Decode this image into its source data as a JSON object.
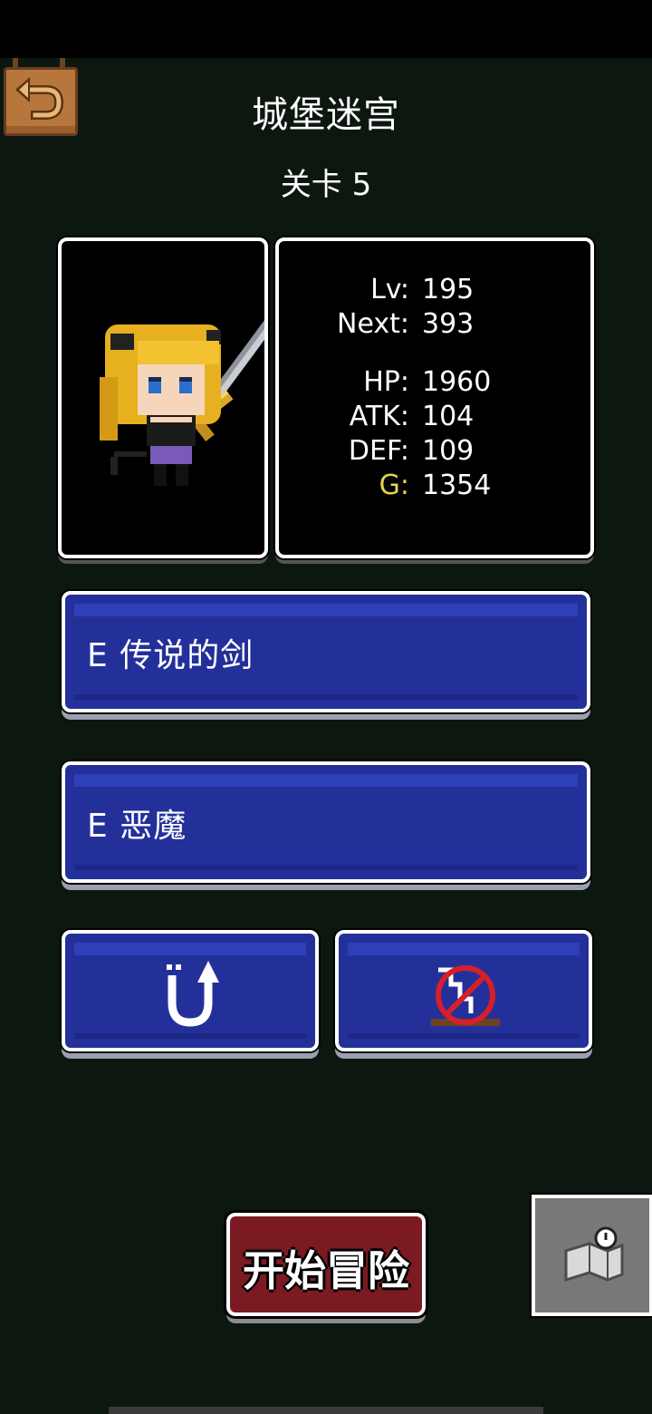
{
  "header": {
    "title": "城堡迷宫",
    "stage": "关卡 5"
  },
  "stats": [
    {
      "label": "Lv:",
      "value": "195"
    },
    {
      "label": "Next:",
      "value": "393"
    },
    {
      "label": "HP:",
      "value": "1960"
    },
    {
      "label": "ATK:",
      "value": "104"
    },
    {
      "label": "DEF:",
      "value": "109"
    },
    {
      "label": "G:",
      "value": "1354"
    }
  ],
  "equipment": {
    "weapon": "E 传说的剑",
    "accessory": "E 恶魔"
  },
  "actions": {
    "upgrade_icon": "u-turn-up-arrow-icon",
    "no_stairs_icon": "no-stairs-icon",
    "start_label": "开始冒险",
    "map_icon": "map-icon",
    "back_icon": "back-arrow-icon"
  },
  "colors": {
    "background": "#0c1710",
    "button_blue": "#24309a",
    "start_red": "#7c1a22",
    "gold_text": "#e9d34a"
  }
}
